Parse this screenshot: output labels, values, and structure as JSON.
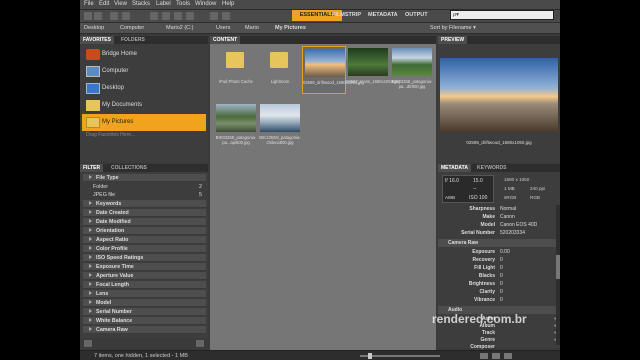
{
  "menu": [
    "File",
    "Edit",
    "View",
    "Stacks",
    "Label",
    "Tools",
    "Window",
    "Help"
  ],
  "workspace": {
    "essentials": "ESSENTIALS",
    "filmstrip": "FILMSTRIP",
    "metadata": "METADATA",
    "output": "OUTPUT",
    "search_placeholder": "ρ▾"
  },
  "path": [
    "Desktop",
    "Computer",
    "Mario2 (C:)",
    "Users",
    "Mario",
    "My Pictures"
  ],
  "sort_label": "Sort by Filename ▾",
  "tabs": {
    "favorites": "FAVORITES",
    "folders": "FOLDERS",
    "content": "CONTENT",
    "preview": "PREVIEW",
    "filter": "FILTER",
    "collections": "COLLECTIONS",
    "metadata": "METADATA",
    "keywords": "KEYWORDS"
  },
  "favorites": [
    "Bridge Home",
    "Computer",
    "Desktop",
    "My Documents",
    "My Pictures"
  ],
  "favorites_hint": "Drag Favorites Here...",
  "filter": {
    "header": "File Type",
    "items": [
      {
        "label": "Folder",
        "count": "2"
      },
      {
        "label": "JPEG file",
        "count": "5"
      }
    ],
    "categories": [
      "Keywords",
      "Date Created",
      "Date Modified",
      "Orientation",
      "Aspect Ratio",
      "Color Profile",
      "ISO Speed Ratings",
      "Exposure Time",
      "Aperture Value",
      "Focal Length",
      "Lens",
      "Model",
      "Serial Number",
      "White Balance",
      "Camera Raw"
    ]
  },
  "thumbs": [
    {
      "caption": "iPod Photo Cache"
    },
    {
      "caption": "Lightroom"
    },
    {
      "caption": "02595_driftwood_1680x1050.jpg"
    },
    {
      "caption": "02597_moss_1680x1050.jpg"
    },
    {
      "caption": "BIK03368_patagonia-pa...dtr800.jpg"
    },
    {
      "caption": "BIK03368_patagonia-pa...api800.jpg"
    },
    {
      "caption": "BIK13926l_patagonia-chilena800.jpg"
    }
  ],
  "preview_caption": "02595_driftwood_1680x1050.jpg",
  "camera_summary": {
    "fstop": "f/ 16.0",
    "shutter": "15.0",
    "dash": "--",
    "awb": "AWB",
    "iso": "ISO 100",
    "dims": "1680 x 1050",
    "size": "1 MB",
    "ppi": "240 ppi",
    "cs": "sRGB",
    "mode": "RGB"
  },
  "metadata_rows": [
    {
      "k": "Sharpness",
      "v": "Normal"
    },
    {
      "k": "Make",
      "v": "Canon"
    },
    {
      "k": "Model",
      "v": "Canon EOS 40D"
    },
    {
      "k": "Serial Number",
      "v": "520203334"
    }
  ],
  "camera_raw_title": "Camera Raw",
  "camera_raw_rows": [
    {
      "k": "Exposure",
      "v": "0.00"
    },
    {
      "k": "Recovery",
      "v": "0"
    },
    {
      "k": "Fill Light",
      "v": "0"
    },
    {
      "k": "Blacks",
      "v": "0"
    },
    {
      "k": "Brightness",
      "v": "0"
    },
    {
      "k": "Clarity",
      "v": "0"
    },
    {
      "k": "Vibrance",
      "v": "0"
    }
  ],
  "audio_title": "Audio",
  "audio_rows": [
    {
      "k": "Artist"
    },
    {
      "k": "Album"
    },
    {
      "k": "Track"
    },
    {
      "k": "Genre"
    },
    {
      "k": "Composer"
    }
  ],
  "status": "7 items, one hidden, 1 selected - 1 MB",
  "watermark": "rendered.com.br"
}
